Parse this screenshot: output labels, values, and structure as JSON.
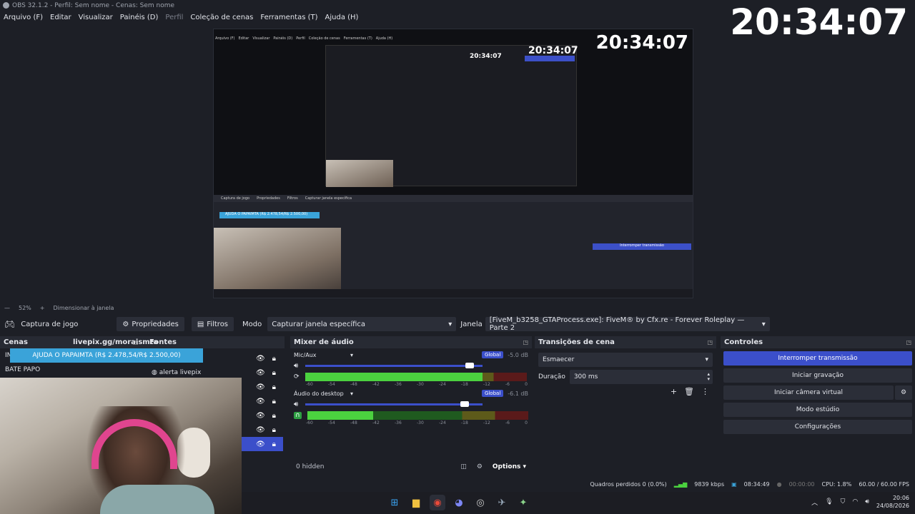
{
  "window": {
    "title": "OBS 32.1.2 - Perfil: Sem nome - Cenas: Sem nome"
  },
  "menu": [
    "Arquivo (F)",
    "Editar",
    "Visualizar",
    "Painéis (D)",
    "Perfil",
    "Coleção de cenas",
    "Ferramentas (T)",
    "Ajuda (H)"
  ],
  "overlay_clock": "20:34:07",
  "preview": {
    "clock": "20:34:07",
    "zoom": "52%",
    "resize_label": "Dimensionar à janela"
  },
  "source_toolbar": {
    "source_name": "Captura de jogo",
    "properties": "Propriedades",
    "filters": "Filtros",
    "mode_label": "Modo",
    "mode_value": "Capturar janela específica",
    "window_label": "Janela",
    "window_value": "[FiveM_b3258_GTAProcess.exe]: FiveM® by Cfx.re - Forever Roleplay — Parte 2"
  },
  "scenes": {
    "title": "Cenas",
    "items": [
      "IN",
      "BATE PAPO"
    ],
    "livepix_tag": "livepix.gg/moraismta"
  },
  "sources": {
    "title": "Fontes",
    "donation_text": "AJUDA O PAPAIMTA (R$ 2.478,54/R$ 2.500,00)",
    "items": [
      "",
      "alerta livepix",
      "",
      "",
      "",
      "",
      ""
    ]
  },
  "mixer": {
    "title": "Mixer de áudio",
    "channels": [
      {
        "name": "Mic/Aux",
        "global": "Global",
        "db": "-5.0 dB",
        "volume": 0.95,
        "level": 0.8
      },
      {
        "name": "Áudio do desktop",
        "global": "Global",
        "db": "-6.1 dB",
        "volume": 0.92,
        "level": 0.3
      }
    ],
    "ticks": [
      "-60",
      "-54",
      "-48",
      "-42",
      "-36",
      "-30",
      "-24",
      "-18",
      "-12",
      "-6",
      "0"
    ],
    "hidden": "0 hidden",
    "options": "Options"
  },
  "transitions": {
    "title": "Transições de cena",
    "selected": "Esmaecer",
    "duration_label": "Duração",
    "duration_value": "300 ms"
  },
  "controls": {
    "title": "Controles",
    "buttons": [
      "Interromper transmissão",
      "Iniciar gravação",
      "Iniciar câmera virtual",
      "Modo estúdio",
      "Configurações"
    ]
  },
  "status": {
    "dropped": "Quadros perdidos 0 (0.0%)",
    "bitrate": "9839 kbps",
    "stream_time": "08:34:49",
    "rec_time": "00:00:00",
    "cpu": "CPU: 1.8%",
    "fps": "60.00 / 60.00 FPS"
  },
  "taskbar": {
    "time": "20:06",
    "date": "24/08/2026"
  }
}
